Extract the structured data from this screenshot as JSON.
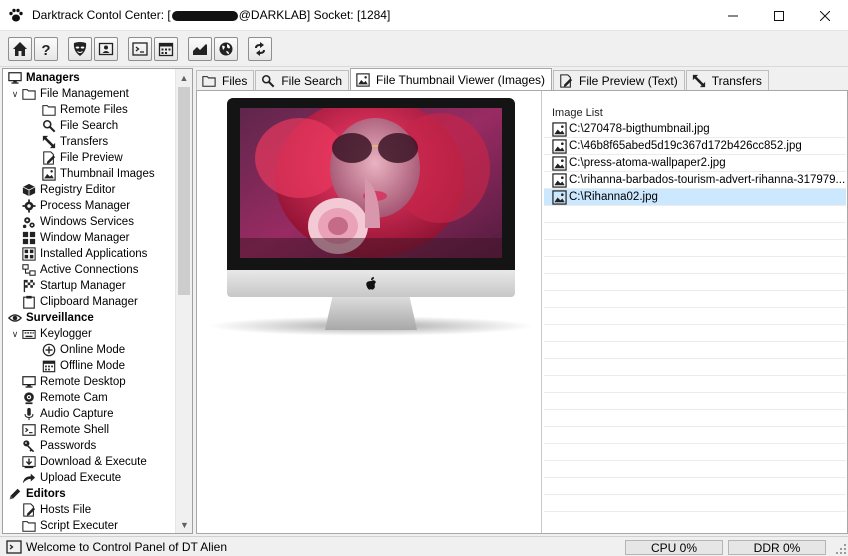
{
  "window": {
    "title_prefix": "Darktrack Contol Center: [",
    "title_suffix": "@DARKLAB] Socket: [1284]",
    "controls": [
      "minimize",
      "maximize",
      "close"
    ]
  },
  "toolbar": {
    "buttons": [
      "home-icon",
      "help-icon",
      "mask-icon",
      "contact-card-icon",
      "terminal-icon",
      "calendar-icon",
      "chart-icon",
      "globe-icon",
      "refresh-icon"
    ]
  },
  "tree": {
    "items": [
      {
        "label": "Managers",
        "icon": "monitor-icon",
        "exp": "",
        "level": 0,
        "bold": true
      },
      {
        "label": "File Management",
        "icon": "folder-icon",
        "exp": "v",
        "level": 1
      },
      {
        "label": "Remote Files",
        "icon": "folder-icon",
        "exp": "",
        "level": 2
      },
      {
        "label": "File Search",
        "icon": "magnifier-icon",
        "exp": "",
        "level": 2
      },
      {
        "label": "Transfers",
        "icon": "transfer-arrows-icon",
        "exp": "",
        "level": 2
      },
      {
        "label": "File Preview",
        "icon": "document-pencil-icon",
        "exp": "",
        "level": 2
      },
      {
        "label": "Thumbnail Images",
        "icon": "image-icon",
        "exp": "",
        "level": 2
      },
      {
        "label": "Registry Editor",
        "icon": "registry-cube-icon",
        "exp": "",
        "level": 1
      },
      {
        "label": "Process Manager",
        "icon": "gear-icon",
        "exp": "",
        "level": 1
      },
      {
        "label": "Windows Services",
        "icon": "gears-icon",
        "exp": "",
        "level": 1
      },
      {
        "label": "Window Manager",
        "icon": "windows-grid-icon",
        "exp": "",
        "level": 1
      },
      {
        "label": "Installed Applications",
        "icon": "apps-icon",
        "exp": "",
        "level": 1
      },
      {
        "label": "Active Connections",
        "icon": "connections-icon",
        "exp": "",
        "level": 1
      },
      {
        "label": "Startup Manager",
        "icon": "startup-flag-icon",
        "exp": "",
        "level": 1
      },
      {
        "label": "Clipboard Manager",
        "icon": "clipboard-icon",
        "exp": "",
        "level": 1
      },
      {
        "label": "Surveillance",
        "icon": "eye-icon",
        "exp": "",
        "level": 0,
        "bold": true
      },
      {
        "label": "Keylogger",
        "icon": "keyboard-icon",
        "exp": "v",
        "level": 1
      },
      {
        "label": "Online Mode",
        "icon": "plus-circle-icon",
        "exp": "",
        "level": 2
      },
      {
        "label": "Offline Mode",
        "icon": "calendar-icon",
        "exp": "",
        "level": 2
      },
      {
        "label": "Remote Desktop",
        "icon": "desktop-icon",
        "exp": "",
        "level": 1
      },
      {
        "label": "Remote Cam",
        "icon": "webcam-icon",
        "exp": "",
        "level": 1
      },
      {
        "label": "Audio Capture",
        "icon": "microphone-icon",
        "exp": "",
        "level": 1
      },
      {
        "label": "Remote Shell",
        "icon": "terminal-icon",
        "exp": "",
        "level": 1
      },
      {
        "label": "Passwords",
        "icon": "key-icon",
        "exp": "",
        "level": 1
      },
      {
        "label": "Download & Execute",
        "icon": "download-icon",
        "exp": "",
        "level": 1
      },
      {
        "label": "Upload Execute",
        "icon": "upload-arrow-icon",
        "exp": "",
        "level": 1
      },
      {
        "label": "Editors",
        "icon": "pencil-icon",
        "exp": "",
        "level": 0,
        "bold": true
      },
      {
        "label": "Hosts File",
        "icon": "document-pencil-icon",
        "exp": "",
        "level": 1
      },
      {
        "label": "Script Executer",
        "icon": "folder-icon",
        "exp": "",
        "level": 1
      }
    ]
  },
  "tabs": [
    {
      "label": "Files",
      "icon": "folder-icon",
      "active": false
    },
    {
      "label": "File Search",
      "icon": "magnifier-icon",
      "active": false
    },
    {
      "label": "File Thumbnail Viewer (Images)",
      "icon": "image-icon",
      "active": true
    },
    {
      "label": "File Preview (Text)",
      "icon": "document-pencil-icon",
      "active": false
    },
    {
      "label": "Transfers",
      "icon": "transfer-arrows-icon",
      "active": false
    }
  ],
  "image_list": {
    "header": "Image List",
    "items": [
      {
        "path": "C:\\270478-bigthumbnail.jpg",
        "selected": false
      },
      {
        "path": "C:\\46b8f65abed5d19c367d172b426cc852.jpg",
        "selected": false
      },
      {
        "path": "C:\\press-atoma-wallpaper2.jpg",
        "selected": false
      },
      {
        "path": "C:\\rihanna-barbados-tourism-advert-rihanna-317979...",
        "selected": false
      },
      {
        "path": "C:\\Rihanna02.jpg",
        "selected": true
      }
    ]
  },
  "status": {
    "message": "Welcome to Control Panel of DT Alien",
    "cpu": "CPU 0%",
    "ddr": "DDR 0%"
  },
  "colors": {
    "selection": "#cce8ff",
    "accent": "#0078d7"
  }
}
